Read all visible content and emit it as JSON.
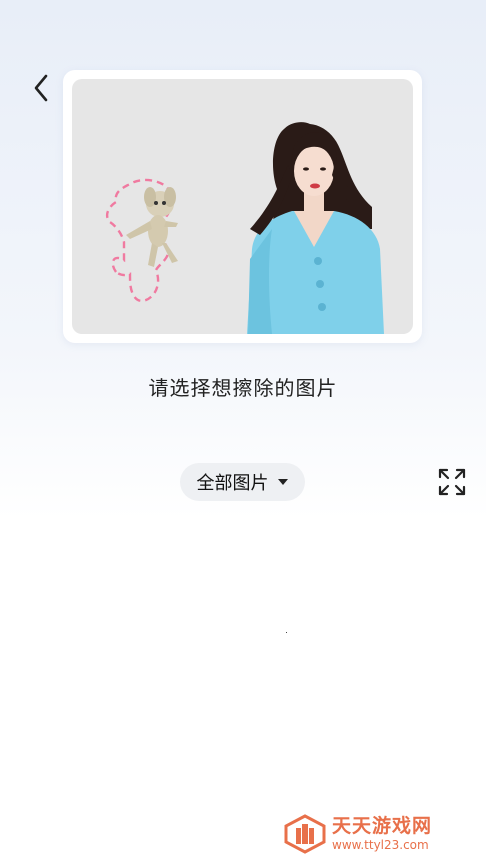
{
  "prompt": "请选择想擦除的图片",
  "album_selector": {
    "label": "全部图片"
  },
  "watermark": {
    "title": "天天游戏网",
    "url": "www.ttyl23.com"
  },
  "icons": {
    "back": "chevron-left-icon",
    "dropdown": "caret-down-icon",
    "fullscreen": "expand-icon"
  }
}
